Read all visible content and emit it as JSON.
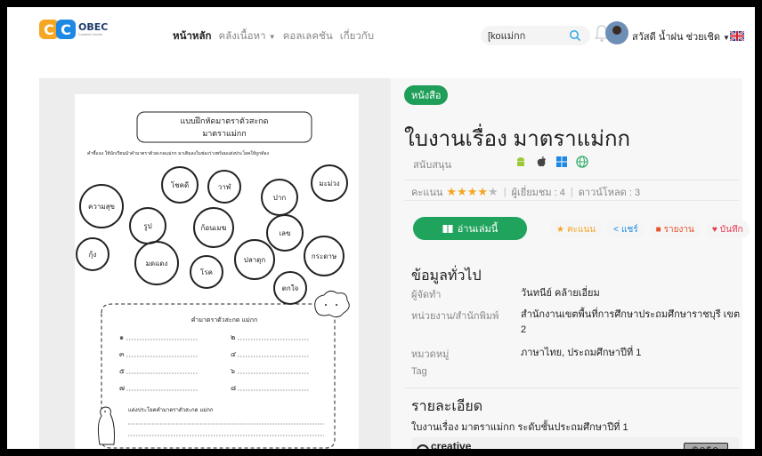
{
  "header": {
    "logo_text": "OBEC",
    "logo_sub": "Content Center",
    "nav": [
      "หน้าหลัก",
      "คลังเนื้อหา",
      "คอลเลคชัน",
      "เกี่ยวกับ"
    ],
    "search_value": "[koแม่กก",
    "user_greeting": "สวัสดี น้ำฝน ช่วยเชิด"
  },
  "resource": {
    "badge": "หนังสือ",
    "title": "ใบงานเรื่อง มาตราแม่กก",
    "support_label": "สนับสนุน",
    "rating_label": "คะแนน",
    "rating": 4,
    "rating_max": 5,
    "views_label": "ผู้เยี่ยมชม : 4",
    "downloads_label": "ดาวน์โหลด : 3",
    "read_button": "อ่านเล่มนี้",
    "actions": [
      "คะแนน",
      "แชร์",
      "รายงาน",
      "บันทึก"
    ]
  },
  "general_info": {
    "title": "ข้อมูลทั่วไป",
    "rows": [
      {
        "k": "ผู้จัดทำ",
        "v": "วันทนีย์ คล้ายเอี่ยม"
      },
      {
        "k": "หน่วยงาน/สำนักพิมพ์",
        "v": "สำนักงานเขตพื้นที่การศึกษาประถมศึกษาราชบุรี เขต 2"
      },
      {
        "k": "หมวดหมู่",
        "v": "ภาษาไทย, ประถมศึกษาปีที่ 1"
      },
      {
        "k": "Tag",
        "v": ""
      }
    ]
  },
  "details": {
    "title": "รายละเอียด",
    "text": "ใบงานเรื่อง มาตราแม่กก ระดับชั้นประถมศึกษาปีที่ 1",
    "cc_text1": "creative",
    "cc_text2": "commons"
  },
  "worksheet": {
    "title1": "แบบฝึกหัดมาตราตัวสะกด",
    "title2": "มาตราแม่กก",
    "instruction": "คำชี้แจง ให้นักเรียนนำคำมาตราตัวสะกดแม่กก มาเติมลงในช่องว่างพร้อมแต่งประโยคให้ถูกต้อง",
    "words": [
      "ความสุข",
      "โชคดี",
      "วาฬ",
      "ปาก",
      "มะม่วง",
      "รูป",
      "ก้อนเมฆ",
      "เลข",
      "กุ้ง",
      "มดแดง",
      "โรค",
      "ปลาดุก",
      "กระดาษ",
      "ตกใจ"
    ],
    "box_title": "คำมาตราตัวสะกด แม่กก",
    "numbers": [
      "๑",
      "๒",
      "๓",
      "๔",
      "๕",
      "๖",
      "๗",
      "๘"
    ],
    "sentence_title": "แต่งประโยคคำมาตราตัวสะกด แม่กก"
  }
}
